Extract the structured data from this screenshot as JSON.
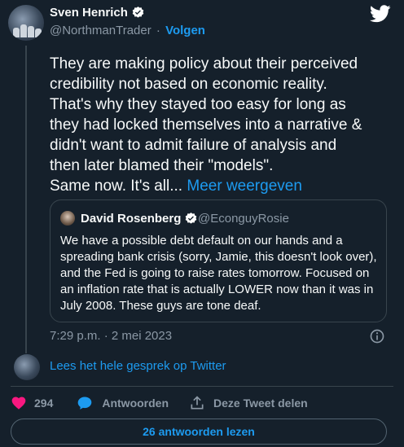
{
  "author": {
    "name": "Sven Henrich",
    "handle": "@NorthmanTrader",
    "separator": "·",
    "follow_label": "Volgen"
  },
  "tweet": {
    "lines": [
      "They are making policy about their perceived",
      "credibility not based on economic reality.",
      "That's why they stayed too easy for long as",
      "they had locked themselves into a narrative &",
      "didn't want to admit failure of analysis and",
      "then later blamed their \"models\"."
    ],
    "last_line": "Same now. It's all...",
    "more_label": "Meer weergeven"
  },
  "quote": {
    "name": "David Rosenberg",
    "handle": "@EconguyRosie",
    "lines": [
      "We have a possible debt default on our hands and a",
      "spreading bank crisis (sorry, Jamie, this doesn't look over),",
      "and the Fed is going to raise rates tomorrow. Focused on",
      "an inflation rate that is actually LOWER now than it was in",
      "July 2008. These guys are tone deaf."
    ]
  },
  "timestamp": "7:29 p.m. · 2 mei 2023",
  "read_conversation": "Lees het hele gesprek op Twitter",
  "actions": {
    "like_count": "294",
    "reply_label": "Antwoorden",
    "share_label": "Deze Tweet delen"
  },
  "read_replies": "26 antwoorden lezen",
  "colors": {
    "background": "#15202b",
    "accent": "#1d9bf0",
    "like": "#f91880",
    "muted": "#8b98a5",
    "border": "#38444d"
  },
  "icons": [
    "verified-badge-icon",
    "twitter-bird-icon",
    "info-icon",
    "heart-icon",
    "reply-bubble-icon",
    "share-icon"
  ]
}
